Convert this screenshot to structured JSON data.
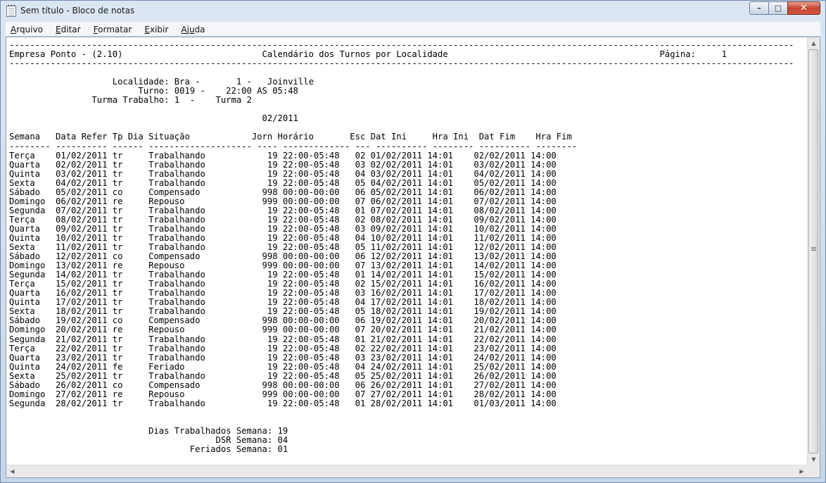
{
  "window": {
    "title": "Sem título - Bloco de notas",
    "minimize_glyph": "–",
    "maximize_glyph": "□",
    "close_glyph": "✕"
  },
  "menu": [
    {
      "label": "Arquivo",
      "key": "A",
      "rest": "rquivo"
    },
    {
      "label": "Editar",
      "key": "E",
      "rest": "ditar"
    },
    {
      "label": "Formatar",
      "key": "F",
      "rest": "ormatar"
    },
    {
      "label": "Exibir",
      "key": "E",
      "rest": "xibir"
    },
    {
      "label": "Ajuda",
      "key": "A",
      "rest": "j",
      "key2": "u",
      "rest2": "da"
    }
  ],
  "document": {
    "lines": [
      "--------------------------------------------------------------------------------------------------------------------------------------------------------",
      "Empresa Ponto - (2.10)                           Calendário dos Turnos por Localidade                                         Página:     1",
      "--------------------------------------------------------------------------------------------------------------------------------------------------------",
      "",
      "                    Localidade: Bra -       1 -   Joinville",
      "                         Turno: 0019 -    22:00 AS 05:48",
      "                Turma Trabalho: 1  -    Turma 2",
      "",
      "                                                 02/2011",
      "",
      "Semana   Data Refer Tp Dia Situação            Jorn Horário       Esc Dat Ini     Hra Ini  Dat Fim    Hra Fim",
      "-------- ---------- ------ -------------------- ---- ------------- --- ---------- -------- ---------- --------",
      "Terça    01/02/2011 tr     Trabalhando            19 22:00-05:48   02 01/02/2011 14:01    02/02/2011 14:00",
      "Quarta   02/02/2011 tr     Trabalhando            19 22:00-05:48   03 02/02/2011 14:01    03/02/2011 14:00",
      "Quinta   03/02/2011 tr     Trabalhando            19 22:00-05:48   04 03/02/2011 14:01    04/02/2011 14:00",
      "Sexta    04/02/2011 tr     Trabalhando            19 22:00-05:48   05 04/02/2011 14:01    05/02/2011 14:00",
      "Sábado   05/02/2011 co     Compensado            998 00:00-00:00   06 05/02/2011 14:01    06/02/2011 14:00",
      "Domingo  06/02/2011 re     Repouso               999 00:00-00:00   07 06/02/2011 14:01    07/02/2011 14:00",
      "Segunda  07/02/2011 tr     Trabalhando            19 22:00-05:48   01 07/02/2011 14:01    08/02/2011 14:00",
      "Terça    08/02/2011 tr     Trabalhando            19 22:00-05:48   02 08/02/2011 14:01    09/02/2011 14:00",
      "Quarta   09/02/2011 tr     Trabalhando            19 22:00-05:48   03 09/02/2011 14:01    10/02/2011 14:00",
      "Quinta   10/02/2011 tr     Trabalhando            19 22:00-05:48   04 10/02/2011 14:01    11/02/2011 14:00",
      "Sexta    11/02/2011 tr     Trabalhando            19 22:00-05:48   05 11/02/2011 14:01    12/02/2011 14:00",
      "Sábado   12/02/2011 co     Compensado            998 00:00-00:00   06 12/02/2011 14:01    13/02/2011 14:00",
      "Domingo  13/02/2011 re     Repouso               999 00:00-00:00   07 13/02/2011 14:01    14/02/2011 14:00",
      "Segunda  14/02/2011 tr     Trabalhando            19 22:00-05:48   01 14/02/2011 14:01    15/02/2011 14:00",
      "Terça    15/02/2011 tr     Trabalhando            19 22:00-05:48   02 15/02/2011 14:01    16/02/2011 14:00",
      "Quarta   16/02/2011 tr     Trabalhando            19 22:00-05:48   03 16/02/2011 14:01    17/02/2011 14:00",
      "Quinta   17/02/2011 tr     Trabalhando            19 22:00-05:48   04 17/02/2011 14:01    18/02/2011 14:00",
      "Sexta    18/02/2011 tr     Trabalhando            19 22:00-05:48   05 18/02/2011 14:01    19/02/2011 14:00",
      "Sábado   19/02/2011 co     Compensado            998 00:00-00:00   06 19/02/2011 14:01    20/02/2011 14:00",
      "Domingo  20/02/2011 re     Repouso               999 00:00-00:00   07 20/02/2011 14:01    21/02/2011 14:00",
      "Segunda  21/02/2011 tr     Trabalhando            19 22:00-05:48   01 21/02/2011 14:01    22/02/2011 14:00",
      "Terça    22/02/2011 tr     Trabalhando            19 22:00-05:48   02 22/02/2011 14:01    23/02/2011 14:00",
      "Quarta   23/02/2011 tr     Trabalhando            19 22:00-05:48   03 23/02/2011 14:01    24/02/2011 14:00",
      "Quinta   24/02/2011 fe     Feriado                19 22:00-05:48   04 24/02/2011 14:01    25/02/2011 14:00",
      "Sexta    25/02/2011 tr     Trabalhando            19 22:00-05:48   05 25/02/2011 14:01    26/02/2011 14:00",
      "Sábado   26/02/2011 co     Compensado            998 00:00-00:00   06 26/02/2011 14:01    27/02/2011 14:00",
      "Domingo  27/02/2011 re     Repouso               999 00:00-00:00   07 27/02/2011 14:01    28/02/2011 14:00",
      "Segunda  28/02/2011 tr     Trabalhando            19 22:00-05:48   01 28/02/2011 14:01    01/03/2011 14:00",
      "",
      "",
      "                           Dias Trabalhados Semana: 19",
      "                                        DSR Semana: 04",
      "                                   Feriados Semana: 01"
    ]
  },
  "scrollbars": {
    "up_glyph": "▲",
    "down_glyph": "▼",
    "left_glyph": "◀",
    "right_glyph": "▶"
  }
}
